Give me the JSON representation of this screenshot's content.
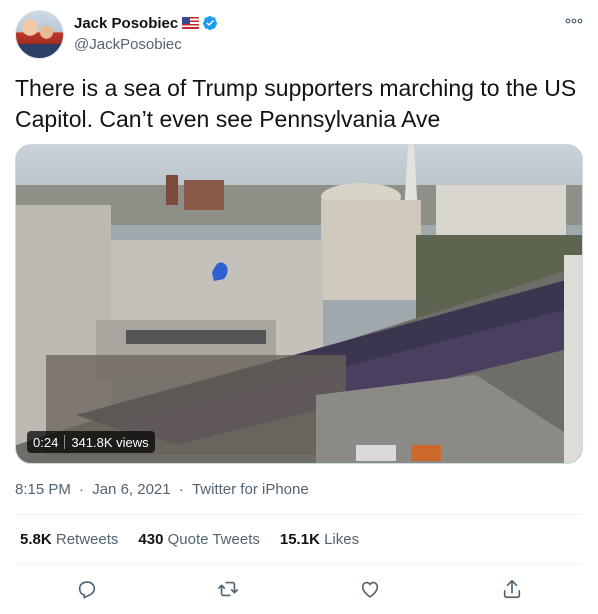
{
  "author": {
    "display_name": "Jack Posobiec",
    "handle": "@JackPosobiec",
    "flag": "us-flag-emoji",
    "verified": true
  },
  "tweet": {
    "text": "There is a sea of Trump supporters marching to the US Capitol. Can’t even see Pennsylvania Ave"
  },
  "video": {
    "duration": "0:24",
    "views": "341.8K views"
  },
  "meta": {
    "time": "8:15 PM",
    "separator": "·",
    "date": "Jan 6, 2021",
    "source": "Twitter for iPhone"
  },
  "stats": {
    "retweets_count": "5.8K",
    "retweets_label": "Retweets",
    "quotes_count": "430",
    "quotes_label": "Quote Tweets",
    "likes_count": "15.1K",
    "likes_label": "Likes"
  },
  "icons": [
    "more-icon",
    "verified-badge-icon",
    "reply-icon",
    "retweet-icon",
    "like-icon",
    "share-icon"
  ],
  "colors": {
    "text": "#0f1419",
    "secondary": "#536471",
    "verified": "#1d9bf0",
    "divider": "#eff3f4"
  }
}
